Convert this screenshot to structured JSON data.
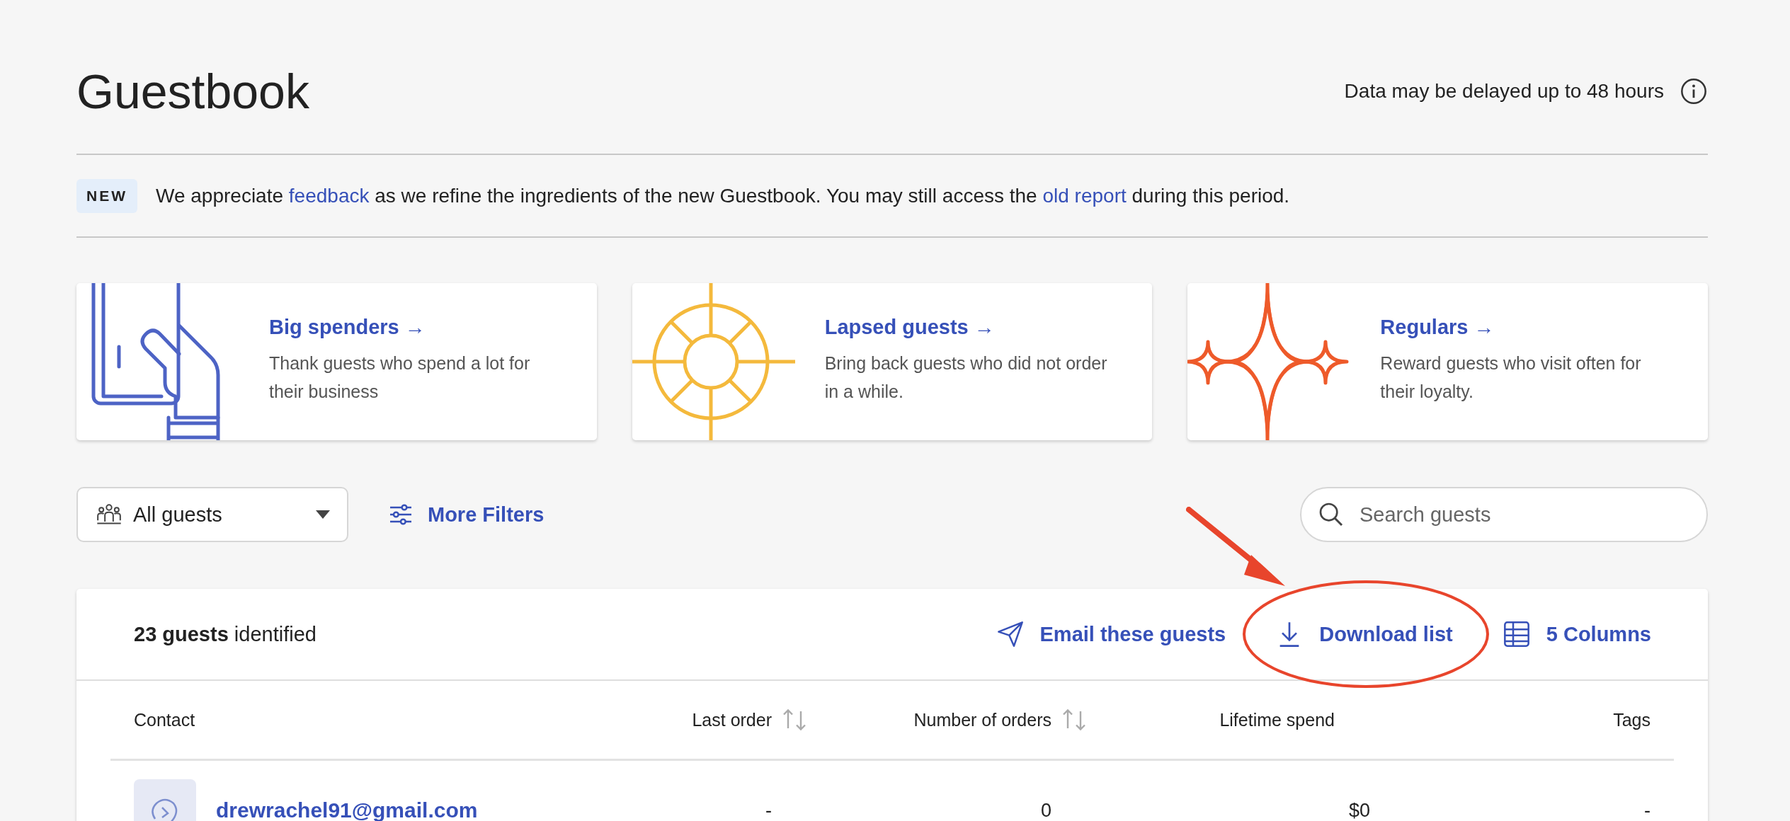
{
  "page": {
    "title": "Guestbook",
    "delay_notice": "Data may be delayed up to 48 hours"
  },
  "banner": {
    "badge": "NEW",
    "segments": [
      {
        "kind": "text",
        "text": "We appreciate "
      },
      {
        "kind": "link",
        "text": "feedback"
      },
      {
        "kind": "text",
        "text": " as we refine the ingredients of the new Guestbook. You may still access the "
      },
      {
        "kind": "link",
        "text": "old report"
      },
      {
        "kind": "text",
        "text": " during this period."
      }
    ]
  },
  "cards": [
    {
      "kind": "hand",
      "title": "Big spenders →",
      "description": "Thank guests who spend a lot for their business"
    },
    {
      "kind": "lifebuoy",
      "title": "Lapsed guests →",
      "description": "Bring back guests who did not order in a while."
    },
    {
      "kind": "sparkles",
      "title": "Regulars →",
      "description": "Reward guests who visit often for their loyalty."
    }
  ],
  "filters": {
    "segment": "All guests",
    "more_filters": "More Filters",
    "search": {
      "placeholder": "Search guests"
    }
  },
  "table": {
    "summary": "**23 guests** identified",
    "actions": [
      {
        "kind": "email",
        "label": "Email these guests",
        "circled": false
      },
      {
        "kind": "download",
        "label": "Download list",
        "circled": true
      },
      {
        "kind": "columns",
        "label": "5 Columns",
        "circled": false
      }
    ],
    "columns": [
      {
        "label": "Contact",
        "sortable": false
      },
      {
        "label": "Last order",
        "sortable": true
      },
      {
        "label": "Number of orders",
        "sortable": true
      },
      {
        "label": "Lifetime spend",
        "sortable": false
      },
      {
        "label": "Tags",
        "sortable": false
      }
    ],
    "rows": [
      {
        "contact": "drewrachel91@gmail.com",
        "last_order": "-",
        "orders": "0",
        "spend": "$0",
        "tags": "-"
      }
    ]
  }
}
